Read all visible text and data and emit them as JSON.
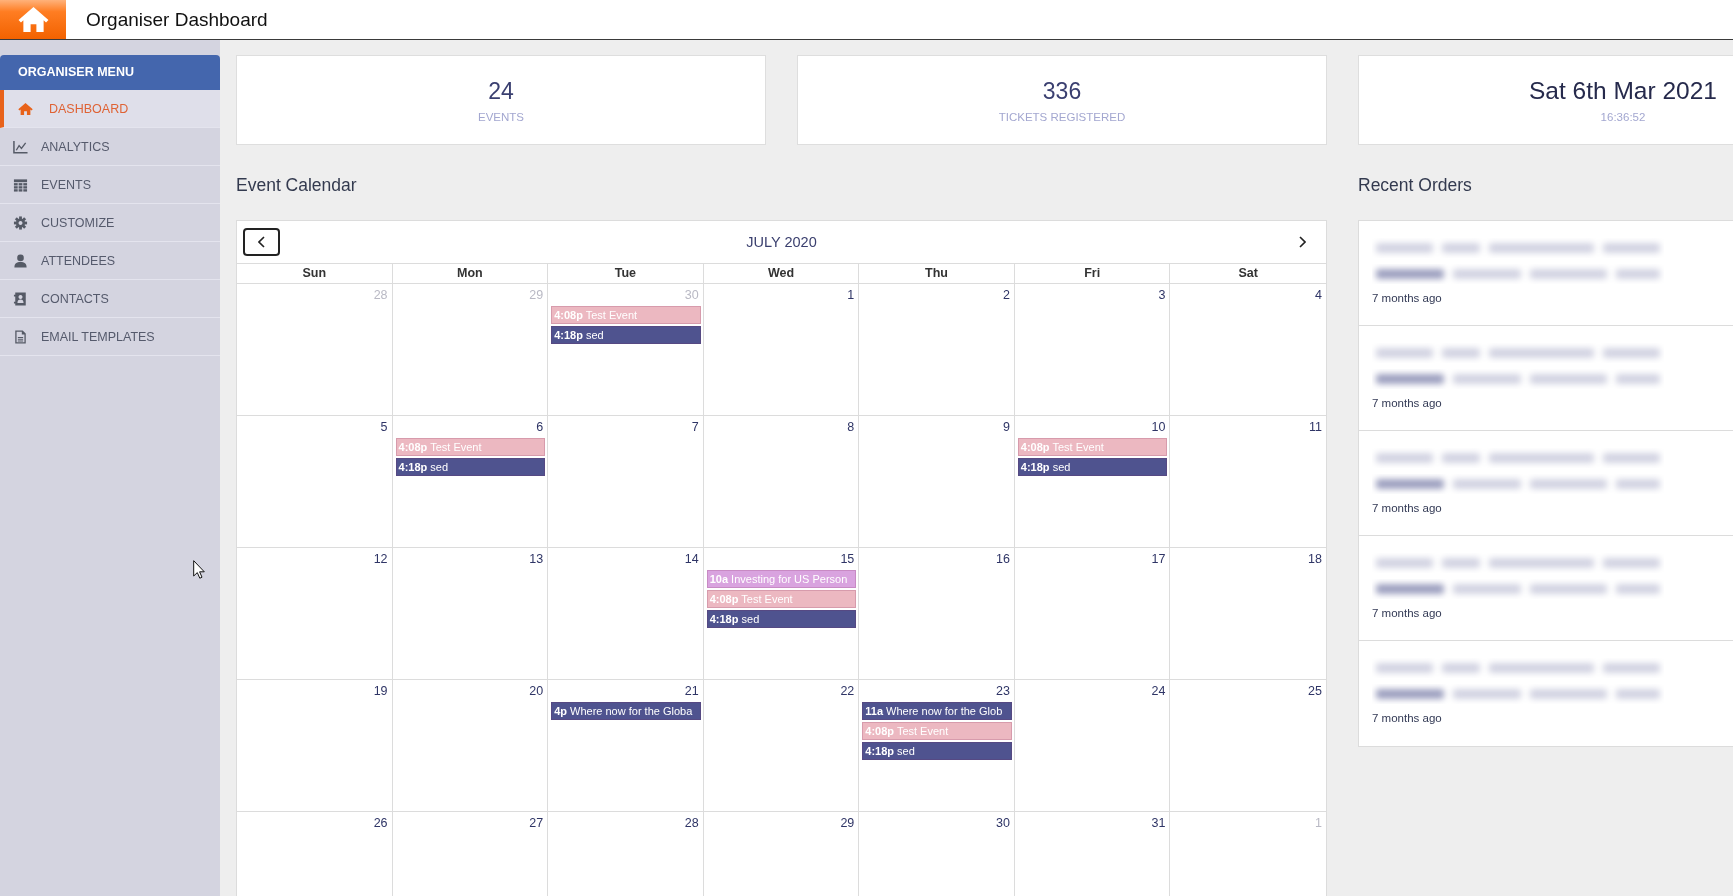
{
  "header": {
    "title": "Organiser Dashboard"
  },
  "sidebar": {
    "title": "ORGANISER MENU",
    "items": [
      {
        "label": "DASHBOARD",
        "selected": true
      },
      {
        "label": "ANALYTICS",
        "selected": false
      },
      {
        "label": "EVENTS",
        "selected": false
      },
      {
        "label": "CUSTOMIZE",
        "selected": false
      },
      {
        "label": "ATTENDEES",
        "selected": false
      },
      {
        "label": "CONTACTS",
        "selected": false
      },
      {
        "label": "EMAIL TEMPLATES",
        "selected": false
      }
    ]
  },
  "stats": [
    {
      "kind": "count",
      "value": "24",
      "label": "EVENTS"
    },
    {
      "kind": "count",
      "value": "336",
      "label": "TICKETS REGISTERED"
    },
    {
      "kind": "clock",
      "value": "Sat 6th Mar 2021",
      "label": "16:36:52"
    }
  ],
  "calendar": {
    "heading": "Event Calendar",
    "month": "JULY 2020",
    "weekdays": [
      "Sun",
      "Mon",
      "Tue",
      "Wed",
      "Thu",
      "Fri",
      "Sat"
    ],
    "weeks": [
      {
        "days": [
          {
            "number": "28",
            "other_month": true
          },
          {
            "number": "29",
            "other_month": true
          },
          {
            "number": "30",
            "other_month": true,
            "events": [
              {
                "time": "4:08p",
                "title": "Test Event",
                "color": "#ecb8c1"
              },
              {
                "time": "4:18p",
                "title": "sed",
                "color": "#4f538f"
              }
            ]
          },
          {
            "number": "1",
            "other_month": false
          },
          {
            "number": "2",
            "other_month": false
          },
          {
            "number": "3",
            "other_month": false
          },
          {
            "number": "4",
            "other_month": false
          }
        ]
      },
      {
        "days": [
          {
            "number": "5",
            "other_month": false
          },
          {
            "number": "6",
            "other_month": false,
            "events": [
              {
                "time": "4:08p",
                "title": "Test Event",
                "color": "#ecb8c1"
              },
              {
                "time": "4:18p",
                "title": "sed",
                "color": "#4f538f"
              }
            ]
          },
          {
            "number": "7",
            "other_month": false
          },
          {
            "number": "8",
            "other_month": false
          },
          {
            "number": "9",
            "other_month": false
          },
          {
            "number": "10",
            "other_month": false,
            "events": [
              {
                "time": "4:08p",
                "title": "Test Event",
                "color": "#ecb8c1"
              },
              {
                "time": "4:18p",
                "title": "sed",
                "color": "#4f538f"
              }
            ]
          },
          {
            "number": "11",
            "other_month": false
          }
        ]
      },
      {
        "days": [
          {
            "number": "12",
            "other_month": false
          },
          {
            "number": "13",
            "other_month": false
          },
          {
            "number": "14",
            "other_month": false
          },
          {
            "number": "15",
            "other_month": false,
            "events": [
              {
                "time": "10a",
                "title": "Investing for US Person",
                "color": "#d9a3df"
              },
              {
                "time": "4:08p",
                "title": "Test Event",
                "color": "#ecb8c1"
              },
              {
                "time": "4:18p",
                "title": "sed",
                "color": "#4f538f"
              }
            ]
          },
          {
            "number": "16",
            "other_month": false
          },
          {
            "number": "17",
            "other_month": false
          },
          {
            "number": "18",
            "other_month": false
          }
        ]
      },
      {
        "days": [
          {
            "number": "19",
            "other_month": false
          },
          {
            "number": "20",
            "other_month": false
          },
          {
            "number": "21",
            "other_month": false,
            "events": [
              {
                "time": "4p",
                "title": "Where now for the Globa",
                "color": "#4f538f"
              }
            ]
          },
          {
            "number": "22",
            "other_month": false
          },
          {
            "number": "23",
            "other_month": false,
            "events": [
              {
                "time": "11a",
                "title": "Where now for the Glob",
                "color": "#4f538f"
              },
              {
                "time": "4:08p",
                "title": "Test Event",
                "color": "#ecb8c1"
              },
              {
                "time": "4:18p",
                "title": "sed",
                "color": "#4f538f"
              }
            ]
          },
          {
            "number": "24",
            "other_month": false
          },
          {
            "number": "25",
            "other_month": false
          }
        ]
      },
      {
        "days": [
          {
            "number": "26",
            "other_month": false
          },
          {
            "number": "27",
            "other_month": false
          },
          {
            "number": "28",
            "other_month": false
          },
          {
            "number": "29",
            "other_month": false
          },
          {
            "number": "30",
            "other_month": false
          },
          {
            "number": "31",
            "other_month": false
          },
          {
            "number": "1",
            "other_month": true
          }
        ]
      }
    ]
  },
  "recent_orders": {
    "heading": "Recent Orders",
    "items": [
      {
        "time": "7 months ago"
      },
      {
        "time": "7 months ago"
      },
      {
        "time": "7 months ago"
      },
      {
        "time": "7 months ago"
      },
      {
        "time": "7 months ago"
      }
    ]
  }
}
